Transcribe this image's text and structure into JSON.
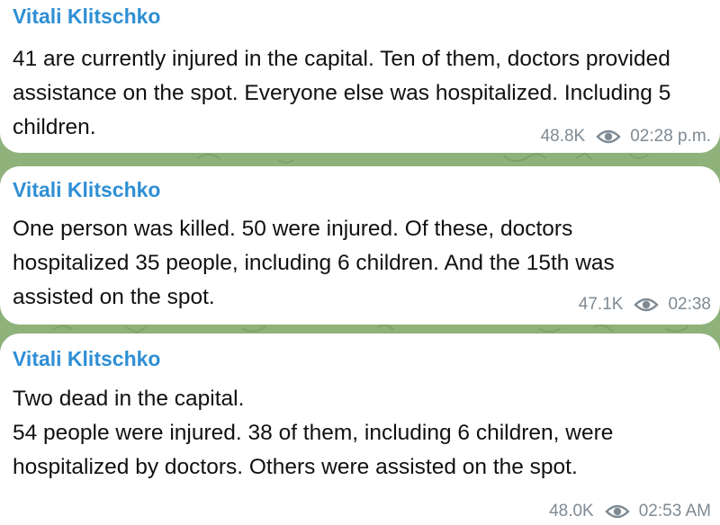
{
  "colors": {
    "background": "#8fb27a",
    "bubble": "#ffffff",
    "sender": "#2f8fd4",
    "text": "#111111",
    "meta": "#7f8a93"
  },
  "messages": [
    {
      "sender": "Vitali Klitschko",
      "lines": [
        "41 are currently injured in the capital. Ten of them, doctors provided",
        "assistance on the spot. Everyone else was hospitalized. Including 5",
        "children."
      ],
      "views": "48.8K",
      "views_icon": "eye-icon",
      "time": "02:28 p.m."
    },
    {
      "sender": "Vitali Klitschko",
      "lines": [
        "One person was killed. 50 were injured. Of these, doctors",
        "hospitalized 35 people, including 6 children. And the 15th was",
        "assisted on the spot."
      ],
      "views": "47.1K",
      "views_icon": "eye-icon",
      "time": "02:38"
    },
    {
      "sender": "Vitali Klitschko",
      "lines": [
        "Two dead in the capital.",
        "54 people were injured. 38 of them, including 6 children, were",
        "hospitalized by doctors. Others were assisted on the spot."
      ],
      "views": "48.0K",
      "views_icon": "eye-icon",
      "time": "02:53 AM"
    }
  ]
}
